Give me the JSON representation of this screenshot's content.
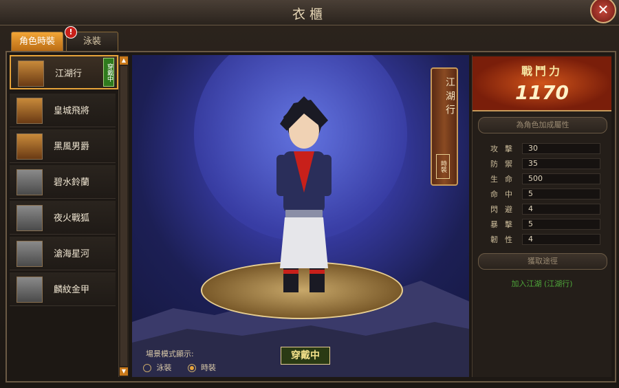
{
  "window": {
    "title": "衣櫃",
    "close_label": "✕"
  },
  "tabs": [
    {
      "label": "角色時裝",
      "active": true
    },
    {
      "label": "泳裝",
      "active": false,
      "alert": "!"
    }
  ],
  "costumes": [
    {
      "name": "江湖行",
      "selected": true,
      "owned": true,
      "tag": "穿戴中"
    },
    {
      "name": "皇城飛將",
      "selected": false,
      "owned": true
    },
    {
      "name": "黑風男爵",
      "selected": false,
      "owned": true
    },
    {
      "name": "碧水鈴蘭",
      "selected": false,
      "owned": false
    },
    {
      "name": "夜火戰狐",
      "selected": false,
      "owned": false
    },
    {
      "name": "滄海星河",
      "selected": false,
      "owned": false
    },
    {
      "name": "麟紋金甲",
      "selected": false,
      "owned": false
    }
  ],
  "preview": {
    "banner_title": "江湖行",
    "banner_sub": "時裝",
    "wearing_label": "穿戴中",
    "display_label": "場景模式顯示:",
    "options": [
      {
        "label": "泳裝",
        "selected": false
      },
      {
        "label": "時裝",
        "selected": true
      }
    ]
  },
  "power": {
    "label": "戰鬥力",
    "value": "1170"
  },
  "attr_header": "為角色加成屬性",
  "stats": [
    {
      "name": "攻擊",
      "value": "30"
    },
    {
      "name": "防禦",
      "value": "35"
    },
    {
      "name": "生命",
      "value": "500"
    },
    {
      "name": "命中",
      "value": "5"
    },
    {
      "name": "閃避",
      "value": "4"
    },
    {
      "name": "暴擊",
      "value": "5"
    },
    {
      "name": "韌性",
      "value": "4"
    }
  ],
  "obtain_header": "獲取途徑",
  "obtain_route": "加入江湖 (江湖行)"
}
